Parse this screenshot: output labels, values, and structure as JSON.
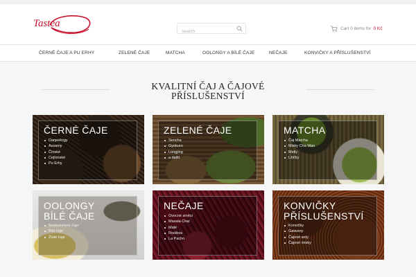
{
  "search": {
    "placeholder": "Search"
  },
  "cart": {
    "label": "Cart 0 items for",
    "amount": "0 Kč"
  },
  "nav": {
    "items": [
      "ČERNÉ ČAJE A PU ERHY",
      "ZELENÉ ČAJE",
      "MATCHA",
      "OOLONGY A BÍLÉ ČAJE",
      "NEČAJE",
      "KONVIČKY A PŘÍSLUŠENSTVÍ"
    ]
  },
  "page": {
    "title_line1": "KVALITNÍ ČAJ A ČAJOVÉ",
    "title_line2": "PŘÍSLUŠENSTVÍ"
  },
  "tiles": [
    {
      "title_lines": [
        "ČERNÉ ČAJE"
      ],
      "items": [
        "Darjeelingy",
        "Assamy",
        "Čínské",
        "Cejlonské",
        "Pu Erhy"
      ]
    },
    {
      "title_lines": [
        "ZELENÉ ČAJE"
      ],
      "items": [
        "Sencha",
        "Gyokuro",
        "Longjing",
        "a další"
      ]
    },
    {
      "title_lines": [
        "MATCHA"
      ],
      "items": [
        "Čaj Matcha",
        "Misky Cha Wan",
        "Metly",
        "Lžičky"
      ]
    },
    {
      "title_lines": [
        "OOLONGY",
        "BÍLÉ ČAJE"
      ],
      "items": [
        "Modrozelené čaje",
        "Bílé čaje",
        "Žluté čaje"
      ]
    },
    {
      "title_lines": [
        "NEČAJE"
      ],
      "items": [
        "Ovocné směsi",
        "Masala Chai",
        "Maté",
        "Rooibos",
        "La Pacho"
      ]
    },
    {
      "title_lines": [
        "KONVIČKY",
        "PŘÍSLUŠENSTVÍ"
      ],
      "items": [
        "Konvičky",
        "Gaiwany",
        "Čajové sety",
        "Čajové misky"
      ]
    }
  ],
  "colors": {
    "accent": "#c8102e",
    "nav_text": "#333333",
    "page_bg": "#f6f6f6"
  },
  "icons": {
    "logo": "tastea-logo",
    "search": "search-icon",
    "cart": "cart-icon"
  }
}
